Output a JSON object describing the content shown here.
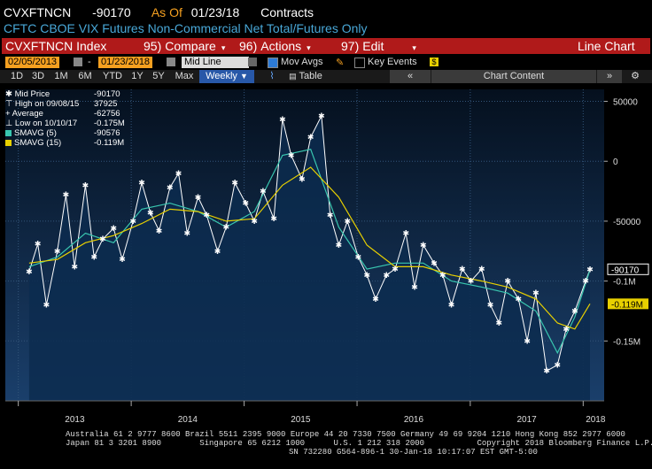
{
  "header": {
    "ticker": "CVXFTNCN",
    "value": "-90170",
    "as_of_label": "As Of",
    "as_of_date": "01/23/18",
    "units": "Contracts",
    "description": "CFTC CBOE VIX Futures Non-Commercial Net Total/Futures Only"
  },
  "menubar": {
    "index_label": "CVXFTNCN Index",
    "compare": {
      "num": "95)",
      "label": "Compare"
    },
    "actions": {
      "num": "96)",
      "label": "Actions"
    },
    "edit": {
      "num": "97)",
      "label": "Edit"
    },
    "chart_type": "Line Chart"
  },
  "date_controls": {
    "start": "02/05/2013",
    "end": "01/23/2018",
    "line_type": "Mid Line",
    "mov_avgs": "Mov Avgs",
    "key_events": "Key Events"
  },
  "toolbar": {
    "ranges": [
      "1D",
      "3D",
      "1M",
      "6M",
      "YTD",
      "1Y",
      "5Y",
      "Max"
    ],
    "period": "Weekly",
    "table": "Table",
    "chart_content": "Chart Content"
  },
  "legend": {
    "mid_price": {
      "label": "Mid Price",
      "value": "-90170"
    },
    "high": {
      "label": "High on 09/08/15",
      "value": "37925"
    },
    "average": {
      "label": "Average",
      "value": "-62756"
    },
    "low": {
      "label": "Low on 10/10/17",
      "value": "-0.175M"
    },
    "smavg5": {
      "label": "SMAVG (5)",
      "value": "-90576"
    },
    "smavg15": {
      "label": "SMAVG (15)",
      "value": "-0.119M"
    }
  },
  "colors": {
    "accent_orange": "#f5a020",
    "menubar_red": "#b01a1a",
    "title_blue": "#49a8d8",
    "mid_price": "#ffffff",
    "smavg5": "#39c7b0",
    "smavg15": "#e8d000",
    "area_fill": "#0c2b4f"
  },
  "footer": {
    "line1": "Australia 61 2 9777 8600 Brazil 5511 2395 9000 Europe 44 20 7330 7500 Germany 49 69 9204 1210 Hong Kong 852 2977 6000",
    "line2": "Japan 81 3 3201 8900        Singapore 65 6212 1000      U.S. 1 212 318 2000           Copyright 2018 Bloomberg Finance L.P.",
    "line3": "SN 732280 G564-896-1 30-Jan-18 10:17:07 EST  GMT-5:00"
  },
  "chart_data": {
    "type": "line",
    "x_labels": [
      "2013",
      "2014",
      "2015",
      "2016",
      "2017",
      "2018"
    ],
    "x_label_dates": [
      "2013-01-01",
      "2014-01-01",
      "2015-01-01",
      "2016-01-01",
      "2017-01-01",
      "2018-01-01"
    ],
    "ylim": [
      -200000,
      60000
    ],
    "y_ticks": [
      50000,
      0,
      -50000,
      -100000,
      -150000
    ],
    "y_tick_labels": [
      "50000",
      "0",
      "-50000",
      "-0.1M",
      "-0.15M"
    ],
    "last_labels": [
      {
        "series": "Mid Price",
        "value": -90170,
        "label": "-90170"
      },
      {
        "series": "SMAVG (15)",
        "value": -119000,
        "label": "-0.119M"
      }
    ],
    "grid": true,
    "series": [
      {
        "name": "Mid Price",
        "x": [
          "2013-02-05",
          "2013-03-05",
          "2013-04-02",
          "2013-05-07",
          "2013-06-04",
          "2013-07-02",
          "2013-08-06",
          "2013-09-03",
          "2013-10-01",
          "2013-11-05",
          "2013-12-03",
          "2014-01-07",
          "2014-02-04",
          "2014-03-04",
          "2014-04-01",
          "2014-05-06",
          "2014-06-03",
          "2014-07-01",
          "2014-08-05",
          "2014-09-02",
          "2014-10-07",
          "2014-11-04",
          "2014-12-02",
          "2015-01-06",
          "2015-02-03",
          "2015-03-03",
          "2015-04-07",
          "2015-05-05",
          "2015-06-02",
          "2015-07-07",
          "2015-08-04",
          "2015-09-08",
          "2015-10-06",
          "2015-11-03",
          "2015-12-01",
          "2016-01-05",
          "2016-02-02",
          "2016-03-01",
          "2016-04-05",
          "2016-05-03",
          "2016-06-07",
          "2016-07-05",
          "2016-08-02",
          "2016-09-06",
          "2016-10-04",
          "2016-11-01",
          "2016-12-06",
          "2017-01-03",
          "2017-02-07",
          "2017-03-07",
          "2017-04-04",
          "2017-05-02",
          "2017-06-06",
          "2017-07-04",
          "2017-08-01",
          "2017-09-05",
          "2017-10-10",
          "2017-11-07",
          "2017-12-05",
          "2018-01-09",
          "2018-01-23"
        ],
        "values": [
          -92000,
          -69000,
          -120000,
          -75000,
          -28000,
          -88000,
          -20000,
          -80000,
          -65000,
          -56000,
          -82000,
          -50000,
          -18000,
          -43000,
          -58000,
          -22000,
          -10000,
          -60000,
          -30000,
          -45000,
          -75000,
          -55000,
          -18000,
          -35000,
          -50000,
          -25000,
          -48000,
          35000,
          5000,
          -15000,
          20000,
          37925,
          -45000,
          -70000,
          -50000,
          -80000,
          -95000,
          -115000,
          -95000,
          -90000,
          -60000,
          -105000,
          -70000,
          -85000,
          -95000,
          -120000,
          -90000,
          -100000,
          -90000,
          -120000,
          -135000,
          -100000,
          -115000,
          -150000,
          -110000,
          -175000,
          -170000,
          -140000,
          -125000,
          -100000,
          -90170
        ]
      },
      {
        "name": "SMAVG (5)",
        "x": [
          "2013-02-05",
          "2013-05-07",
          "2013-08-06",
          "2013-11-05",
          "2014-02-04",
          "2014-05-06",
          "2014-08-05",
          "2014-11-04",
          "2015-02-03",
          "2015-05-05",
          "2015-08-04",
          "2015-11-03",
          "2016-02-02",
          "2016-05-03",
          "2016-08-02",
          "2016-11-01",
          "2017-02-07",
          "2017-05-02",
          "2017-08-01",
          "2017-10-10",
          "2017-12-05",
          "2018-01-23"
        ],
        "values": [
          -88000,
          -80000,
          -60000,
          -68000,
          -40000,
          -35000,
          -42000,
          -55000,
          -42000,
          5000,
          10000,
          -55000,
          -90000,
          -85000,
          -85000,
          -100000,
          -105000,
          -110000,
          -125000,
          -160000,
          -130000,
          -90576
        ]
      },
      {
        "name": "SMAVG (15)",
        "x": [
          "2013-02-05",
          "2013-05-07",
          "2013-08-06",
          "2013-11-05",
          "2014-02-04",
          "2014-05-06",
          "2014-08-05",
          "2014-11-04",
          "2015-02-03",
          "2015-05-05",
          "2015-08-04",
          "2015-11-03",
          "2016-02-02",
          "2016-05-03",
          "2016-08-02",
          "2016-11-01",
          "2017-02-07",
          "2017-05-02",
          "2017-08-01",
          "2017-10-10",
          "2017-12-05",
          "2018-01-23"
        ],
        "values": [
          -85000,
          -82000,
          -68000,
          -62000,
          -52000,
          -40000,
          -42000,
          -50000,
          -48000,
          -20000,
          -5000,
          -30000,
          -70000,
          -88000,
          -88000,
          -95000,
          -100000,
          -105000,
          -115000,
          -135000,
          -140000,
          -119000
        ]
      }
    ]
  }
}
